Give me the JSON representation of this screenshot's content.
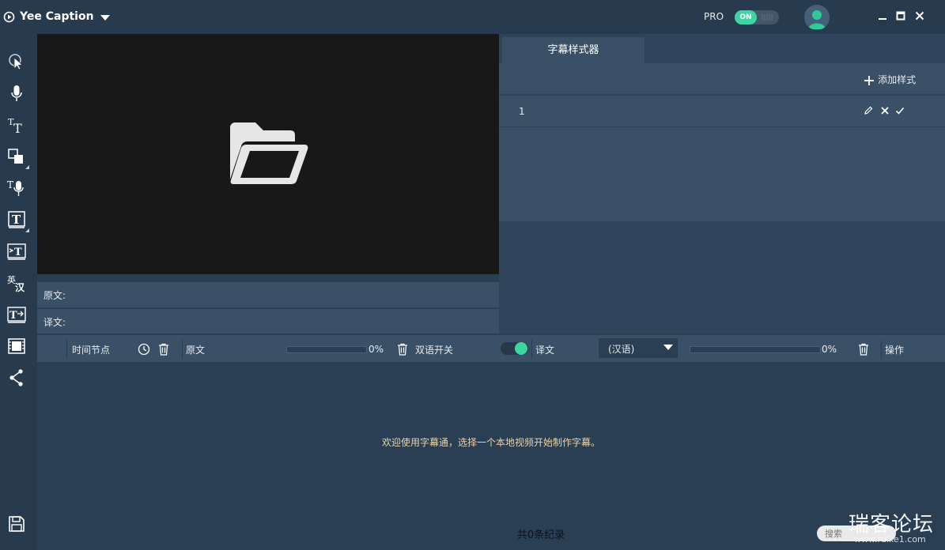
{
  "titlebar": {
    "app_title": "Yee Caption",
    "pro_label": "PRO",
    "pro_toggle_label": "ON",
    "pro_enabled": true
  },
  "preview": {
    "source_label": "原文:",
    "translation_label": "译文:"
  },
  "style_panel": {
    "tab_label": "字幕样式器",
    "add_style_label": "添加样式",
    "rows": [
      {
        "index": "1"
      }
    ]
  },
  "table": {
    "col_timecode": "时间节点",
    "col_source": "原文",
    "source_progress_pct": 0,
    "source_progress_label": "0%",
    "col_bilingual": "双语开关",
    "bilingual_enabled": true,
    "col_translation": "译文",
    "language_selected": "(汉语)",
    "translation_progress_pct": 0,
    "translation_progress_label": "0%",
    "col_actions": "操作",
    "welcome_message": "欢迎使用字幕通，选择一个本地视频开始制作字幕。",
    "record_count": "共0条纪录",
    "search_placeholder": "搜索"
  },
  "watermark": {
    "text": "瑞客论坛",
    "url": "www.ruike1.com"
  },
  "colors": {
    "accent_green": "#3dd6a0",
    "panel": "#3a5067",
    "background": "#2a3e54",
    "preview_bg": "#181818"
  },
  "icons": {
    "toolbar": [
      "pointer-icon",
      "microphone-icon",
      "text-size-icon",
      "shapes-icon",
      "text-voice-icon",
      "text-box-icon",
      "text-import-icon",
      "translate-icon",
      "text-export-icon",
      "film-icon",
      "share-icon",
      "save-icon"
    ]
  }
}
